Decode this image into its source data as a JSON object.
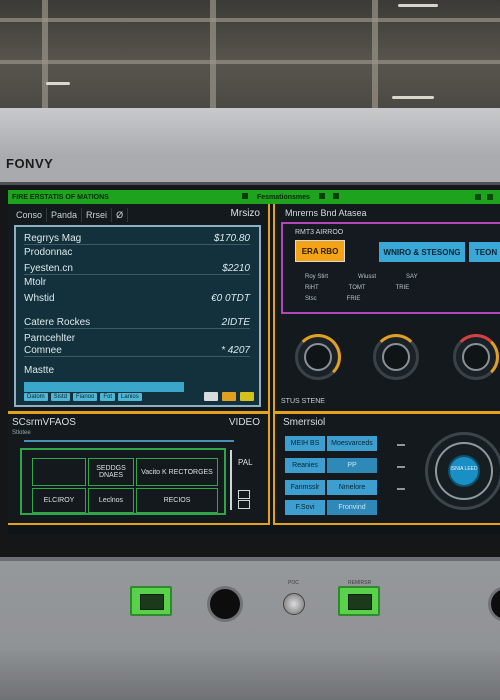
{
  "brand": "FONVY",
  "status_bar": {
    "left": "FIRE ERSTATIS OF MATIONS",
    "middle": "Fesmationsmes"
  },
  "panel_main": {
    "tabs": [
      "Conso",
      "Panda",
      "Rrsei",
      "Ø"
    ],
    "title": "Mrsizo",
    "rows": [
      {
        "label": "Regrrys Mag",
        "value": "$170.80"
      },
      {
        "label": "Prodonnac",
        "value": ""
      },
      {
        "label": "Fyesten.cn",
        "value": "$2210"
      },
      {
        "label": "Mtolr",
        "value": ""
      },
      {
        "label": "Whstid",
        "value": "€0 0TDT"
      },
      {
        "label": "Catere Rockes",
        "value": "2IDTE"
      },
      {
        "label": "Parncehlter",
        "value": ""
      },
      {
        "label": "Comnee",
        "value": "* 4207"
      },
      {
        "label": "Mastte",
        "value": ""
      }
    ],
    "buttons": [
      "Datom",
      "Sistd",
      "Fianoo",
      "Fot",
      "Lanios"
    ]
  },
  "panel_status": {
    "title": "Mnrerns Bnd Atasea",
    "box_label": "RMT3 AIRROO",
    "orange_button": "ERA RBO",
    "blue_buttons": [
      "WNIRO & STESONG",
      "TEON"
    ],
    "readouts": [
      [
        "Roy Stirt",
        "Wiusst",
        "SAY"
      ],
      [
        "RiHT",
        "TOMT",
        "TRIE"
      ],
      [
        "Stsc",
        "FRIE",
        ""
      ]
    ],
    "footer": "STUS STENE"
  },
  "panel_controls": {
    "title": "SCsrmVFAOS",
    "subtitle": "Stlotee",
    "right": "VIDEO",
    "cells": [
      "",
      "SEDDGS DNAES",
      "Vacito K RECTORGES",
      "ELCIROY",
      "Leclnos",
      "RECIOS"
    ],
    "side": "PAL"
  },
  "panel_output": {
    "title": "Smerrsiol",
    "buttons": [
      [
        "MEIH BS",
        "Moesvarceds"
      ],
      [
        "Reanies",
        "PP"
      ],
      [
        "Fanmsslr",
        "Nmelore"
      ],
      [
        "F.Sovi",
        "Fronvind"
      ]
    ],
    "dial_label": "ISNIA LEED"
  },
  "control_panel": {
    "label_left": "POC",
    "label_right": "REMIRSR"
  }
}
